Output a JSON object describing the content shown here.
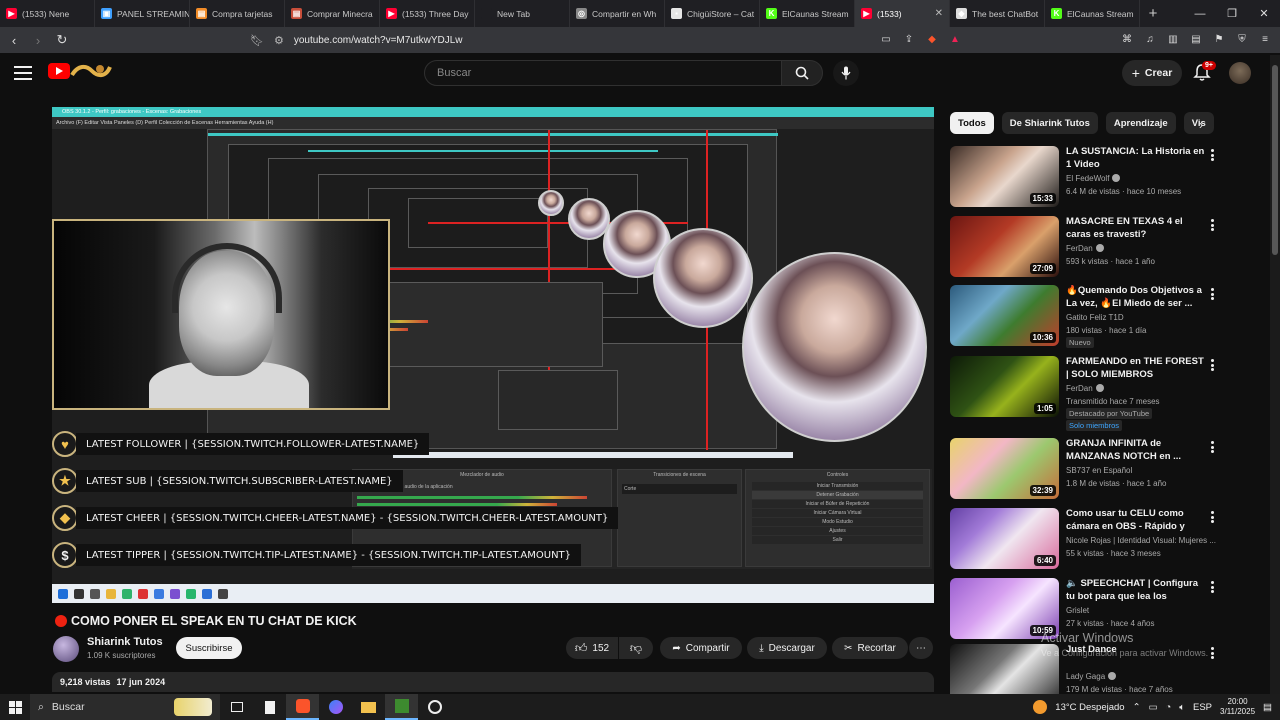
{
  "browser": {
    "tabs": [
      {
        "label": "(1533) Nene",
        "fav_color": "#ff0033",
        "fav_glyph": "▶"
      },
      {
        "label": "PANEL STREAMIN",
        "fav_color": "#3fa0ff",
        "fav_glyph": "▣"
      },
      {
        "label": "Compra tarjetas",
        "fav_color": "#f28c28",
        "fav_glyph": "▤"
      },
      {
        "label": "Comprar Minecra",
        "fav_color": "#c84e3a",
        "fav_glyph": "▤"
      },
      {
        "label": "(1533) Three Day",
        "fav_color": "#ff0033",
        "fav_glyph": "▶"
      },
      {
        "label": "New Tab",
        "fav_color": "#1f1f23",
        "fav_glyph": ""
      },
      {
        "label": "Compartir en Wh",
        "fav_color": "#888888",
        "fav_glyph": "◎"
      },
      {
        "label": "ChigüiStore – Cat",
        "fav_color": "#e6e6e6",
        "fav_glyph": "▪"
      },
      {
        "label": "ElCaunas Stream",
        "fav_color": "#53fc18",
        "fav_glyph": "K"
      },
      {
        "label": "(1533)",
        "fav_color": "#ff0033",
        "fav_glyph": "▶",
        "active": true
      },
      {
        "label": "The best ChatBot",
        "fav_color": "#dddddd",
        "fav_glyph": "◆"
      },
      {
        "label": "ElCaunas Stream",
        "fav_color": "#53fc18",
        "fav_glyph": "K"
      }
    ],
    "url": "youtube.com/watch?v=M7utkwYDJLw"
  },
  "header": {
    "search_placeholder": "Buscar",
    "create_label": "Crear",
    "notif_badge": "9+"
  },
  "player": {
    "obs_title": "OBS 30.1.2 - Perfil: grabaciones - Escenas: Grabaciones",
    "obs_menu": "Archivo (F)   Editar   Vista   Paneles (D)   Perfil   Colección de Escenas   Herramientas   Ayuda (H)",
    "obs_panels": {
      "audio_mixer": "Mezclador de audio",
      "transitions": "Transiciones de escena",
      "controls": "Controles",
      "audio_source": "Captura de salida de audio de la aplicación",
      "transition_mode": "Corte",
      "control_buttons": [
        "Iniciar Transmisión",
        "Detener Grabación",
        "Iniciar el Búfer de Repetición",
        "Iniciar Cámara Virtual",
        "Modo Estudio",
        "Ajustes",
        "Salir"
      ]
    },
    "overlays": [
      {
        "glyph": "♥",
        "color": "#f2c14e",
        "text": "LATEST FOLLOWER | {SESSION.TWITCH.FOLLOWER-LATEST.NAME}"
      },
      {
        "glyph": "★",
        "color": "#f2c14e",
        "text": "LATEST SUB | {SESSION.TWITCH.SUBSCRIBER-LATEST.NAME}"
      },
      {
        "glyph": "◆",
        "color": "#f2c14e",
        "text": "LATEST CHEER | {SESSION.TWITCH.CHEER-LATEST.NAME} - {SESSION.TWITCH.CHEER-LATEST.AMOUNT}"
      },
      {
        "glyph": "$",
        "color": "#f2f2f2",
        "text": "LATEST TIPPER | {SESSION.TWITCH.TIP-LATEST.NAME} -  {SESSION.TWITCH.TIP-LATEST.AMOUNT}"
      }
    ]
  },
  "video": {
    "title": "COMO PONER EL SPEAK EN TU CHAT DE KICK",
    "channel": "Shiarink Tutos",
    "subscribers": "1.09 K suscriptores",
    "subscribe_label": "Suscribirse",
    "likes": "152",
    "share_label": "Compartir",
    "download_label": "Descargar",
    "clip_label": "Recortar",
    "views": "9,218 vistas",
    "date": "17 jun 2024"
  },
  "sidebar": {
    "chips": [
      "Todos",
      "De Shiarink Tutos",
      "Aprendizaje",
      "Vis"
    ],
    "recommendations": [
      {
        "title": "LA SUSTANCIA: La Historia en 1 Video",
        "channel": "El FedeWolf",
        "verified": true,
        "meta": "6.4 M de vistas · hace 10 meses",
        "duration": "15:33",
        "thumb": "linear-gradient(135deg,#3b2d27 0%,#c9a48d 40%,#e8d7cc 55%,#1d1a18 100%)"
      },
      {
        "title": "MASACRE EN TEXAS 4 el caras es travesti?",
        "channel": "FerDan",
        "verified": true,
        "meta": "593 k vistas · hace 1 año",
        "duration": "27:09",
        "thumb": "linear-gradient(135deg,#6b1612 0%,#b33a25 40%,#d9a06b 65%,#2a0e0c 100%)"
      },
      {
        "title": "🔥Quemando Dos Objetivos a La vez, 🔥El Miedo de ser ...",
        "channel": "Gatito Feliz T1D",
        "verified": false,
        "meta": "180 vistas · hace 1 día",
        "badge": "Nuevo",
        "duration": "10:36",
        "thumb": "linear-gradient(135deg,#2c5a7c 0%,#6fa8c8 35%,#3e7c2f 60%,#c23c2c 100%)"
      },
      {
        "title": "FARMEANDO en THE FOREST | SOLO MIEMBROS",
        "channel": "FerDan",
        "verified": true,
        "meta": "Transmitido hace 7 meses",
        "badge": "Destacado por YouTube",
        "badge2": "Solo miembros",
        "duration": "1:05",
        "thumb": "linear-gradient(135deg,#0d1a08 0%,#2f5214 40%,#97b21c 60%,#0a1006 100%)"
      },
      {
        "title": "GRANJA INFINITA de MANZANAS NOTCH en ...",
        "channel": "SB737 en Español",
        "verified": false,
        "meta": "1.8 M de vistas · hace 1 año",
        "duration": "32:39",
        "thumb": "linear-gradient(135deg,#e8d36b 0%,#f2b7c5 35%,#9cc86f 60%,#c56d3a 100%)"
      },
      {
        "title": "Como usar tu CELU como cámara en OBS - Rápido y Fácil",
        "channel": "Nicole Rojas | Identidad Visual: Mujeres ...",
        "verified": false,
        "meta": "55 k vistas · hace 3 meses",
        "duration": "6:40",
        "thumb": "linear-gradient(135deg,#6441a5 0%,#a27bd8 30%,#f0e6f0 55%,#d86a9c 100%)"
      },
      {
        "title": "🔈 SPEECHCHAT | Configura tu bot para que lea los mensajes ...",
        "channel": "Grislet",
        "verified": false,
        "meta": "27 k vistas · hace 4 años",
        "duration": "10:59",
        "thumb": "linear-gradient(135deg,#9b5fd0 0%,#d7a1f0 40%,#f6e4ff 60%,#7b3fb0 100%)"
      },
      {
        "title": "Just Dance",
        "channel": "Lady Gaga",
        "verified": true,
        "meta": "179 M de vistas · hace 7 años",
        "duration": "",
        "thumb": "linear-gradient(135deg,#111 0%,#777 40%,#e4e4e4 55%,#222 100%)"
      }
    ]
  },
  "watermark": {
    "title": "Activar Windows",
    "subtitle": "Ve a Configuración para activar Windows."
  },
  "taskbar": {
    "search_placeholder": "Buscar",
    "weather": "13°C  Despejado",
    "lang": "ESP",
    "time": "20:00",
    "date": "3/11/2025"
  }
}
